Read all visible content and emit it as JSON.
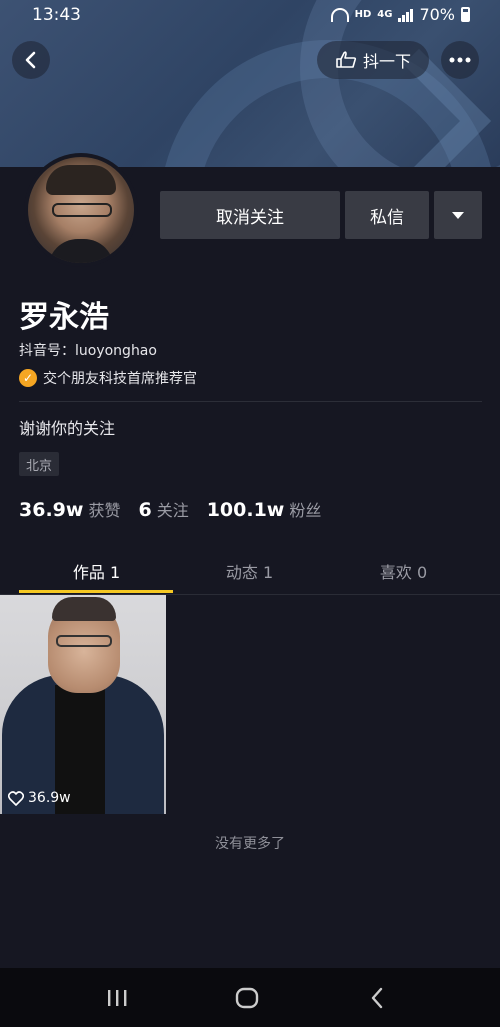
{
  "status": {
    "time": "13:43",
    "hd": "HD",
    "net": "4G",
    "battery": "70%"
  },
  "header": {
    "douyixia_label": "抖一下"
  },
  "actions": {
    "unfollow_label": "取消关注",
    "message_label": "私信"
  },
  "profile": {
    "name": "罗永浩",
    "douyin_id": "抖音号：luoyonghao",
    "verification": "交个朋友科技首席推荐官",
    "bio": "谢谢你的关注",
    "location": "北京"
  },
  "stats": [
    {
      "value": "36.9w",
      "label": "获赞"
    },
    {
      "value": "6",
      "label": "关注"
    },
    {
      "value": "100.1w",
      "label": "粉丝"
    }
  ],
  "tabs": [
    {
      "label": "作品 1",
      "active": true
    },
    {
      "label": "动态 1",
      "active": false
    },
    {
      "label": "喜欢 0",
      "active": false
    }
  ],
  "works": [
    {
      "likes": "36.9w"
    }
  ],
  "footer": {
    "no_more": "没有更多了"
  },
  "colors": {
    "accent": "#f5c823",
    "background": "#161722",
    "button": "#393b44",
    "verify_badge": "#f5a623"
  },
  "icons": {
    "back": "chevron-left-icon",
    "more": "more-horizontal-icon",
    "hand": "pointing-hand-icon",
    "heart": "heart-icon"
  }
}
